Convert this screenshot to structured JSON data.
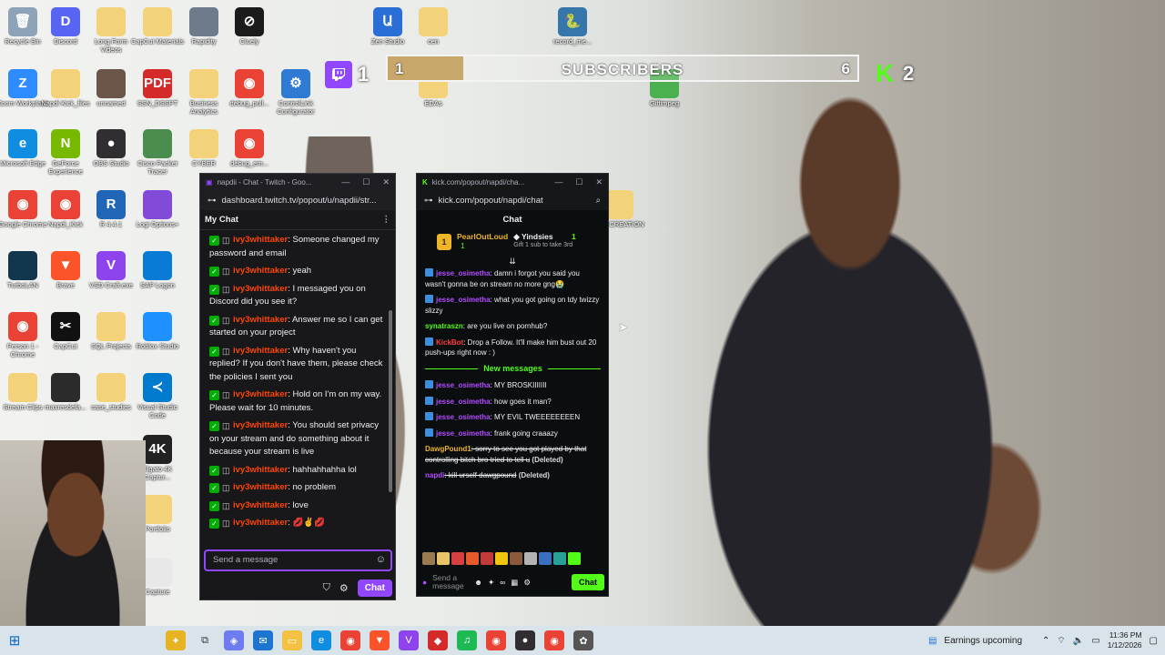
{
  "desktop": {
    "icons": [
      {
        "label": "Recycle Bin",
        "glyph": "🗑",
        "color": "#8fa3b8"
      },
      {
        "label": "Discord",
        "glyph": "D",
        "color": "#5865f2"
      },
      {
        "label": "Long Form Videos",
        "glyph": "",
        "color": "#f3d27a"
      },
      {
        "label": "CapCut Materials",
        "glyph": "",
        "color": "#f3d27a"
      },
      {
        "label": "Rapidity",
        "glyph": "",
        "color": "#6e7b8b"
      },
      {
        "label": "Cluely",
        "glyph": "⊘",
        "color": "#1b1b1b"
      },
      {
        "label": "Zen Studio",
        "glyph": "Ա",
        "color": "#2b6fd6"
      },
      {
        "label": "cen",
        "glyph": "",
        "color": "#f3d27a"
      },
      {
        "label": "record_me...",
        "glyph": "🐍",
        "color": "#3776ab"
      },
      {
        "label": "Zoom Workplace",
        "glyph": "Z",
        "color": "#2d8cff"
      },
      {
        "label": "Napdi Kick_files",
        "glyph": "",
        "color": "#f3d27a"
      },
      {
        "label": "unnamed",
        "glyph": "",
        "color": "#6b5548"
      },
      {
        "label": "SSN_DSSPT",
        "glyph": "PDF",
        "color": "#d42a2a"
      },
      {
        "label": "Business Analytics",
        "glyph": "",
        "color": "#f3d27a"
      },
      {
        "label": "debug_pull...",
        "glyph": "◉",
        "color": "#ea4335"
      },
      {
        "label": "ControlLink Configurator",
        "glyph": "⚙",
        "color": "#2f7bd3"
      },
      {
        "label": "EDAs",
        "glyph": "",
        "color": "#f3d27a"
      },
      {
        "label": "Giftimpeg",
        "glyph": "",
        "color": "#4caf50"
      },
      {
        "label": "Microsoft Edge",
        "glyph": "e",
        "color": "#0f8de0"
      },
      {
        "label": "GeForce Experience",
        "glyph": "N",
        "color": "#76b900"
      },
      {
        "label": "OBS Studio",
        "glyph": "●",
        "color": "#302e31"
      },
      {
        "label": "Cisco Packet Tracer",
        "glyph": "",
        "color": "#4a8d4f"
      },
      {
        "label": "CYBER",
        "glyph": "",
        "color": "#f3d27a"
      },
      {
        "label": "debug_em...",
        "glyph": "◉",
        "color": "#ea4335"
      },
      {
        "label": "Google Chrome",
        "glyph": "◉",
        "color": "#ea4335"
      },
      {
        "label": "Napdi_Kick",
        "glyph": "◉",
        "color": "#ea4335"
      },
      {
        "label": "R 4.4.1",
        "glyph": "R",
        "color": "#2165b6"
      },
      {
        "label": "Logi Options+",
        "glyph": "",
        "color": "#814ad8"
      },
      {
        "label": "APP CREATION",
        "glyph": "",
        "color": "#f3d27a"
      },
      {
        "label": "TurboLAN",
        "glyph": "",
        "color": "#13364f"
      },
      {
        "label": "Brave",
        "glyph": "▼",
        "color": "#fb542b"
      },
      {
        "label": "VSD Craft.exe",
        "glyph": "V",
        "color": "#8e44ec"
      },
      {
        "label": "SAP Logon",
        "glyph": "",
        "color": "#0a7bd4"
      },
      {
        "label": "Person 1 - Chrome",
        "glyph": "◉",
        "color": "#ea4335"
      },
      {
        "label": "CapCut",
        "glyph": "✂",
        "color": "#111111"
      },
      {
        "label": "SQL Projects",
        "glyph": "",
        "color": "#f3d27a"
      },
      {
        "label": "Roblox Studio",
        "glyph": "",
        "color": "#1e90ff"
      },
      {
        "label": "Stream Clips",
        "glyph": "",
        "color": "#f3d27a"
      },
      {
        "label": "maxresdefa...",
        "glyph": "",
        "color": "#2b2b2b"
      },
      {
        "label": "case_studies",
        "glyph": "",
        "color": "#f3d27a"
      },
      {
        "label": "Visual Studio Code",
        "glyph": "≺",
        "color": "#007acc"
      },
      {
        "label": "Elgato 4K Captur...",
        "glyph": "4K",
        "color": "#222222"
      },
      {
        "label": "Portfolio",
        "glyph": "",
        "color": "#f3d27a"
      },
      {
        "label": "Capture",
        "glyph": "",
        "color": "#e8e8e8"
      }
    ]
  },
  "overlay": {
    "twitch_count": "1",
    "kick_count": "2",
    "subscribers": {
      "current": "1",
      "goal": "6",
      "label": "SUBSCRIBERS",
      "progress": 0.16
    }
  },
  "twitch": {
    "window_title": "napdii - Chat - Twitch - Goo...",
    "url": "dashboard.twitch.tv/popout/u/napdii/str...",
    "header": "My Chat",
    "messages": [
      {
        "user": "ivy3whittaker",
        "text": ": Someone changed my password and email"
      },
      {
        "user": "ivy3whittaker",
        "text": ": yeah"
      },
      {
        "user": "ivy3whittaker",
        "text": ": I messaged you on Discord did you see it?"
      },
      {
        "user": "ivy3whittaker",
        "text": ": Answer me so I can get started on your project"
      },
      {
        "user": "ivy3whittaker",
        "text": ": Why haven't you replied? If you don't have them, please check the policies I sent you"
      },
      {
        "user": "ivy3whittaker",
        "text": ": Hold on I'm on my way. Please wait for 10 minutes."
      },
      {
        "user": "ivy3whittaker",
        "text": ": You should set privacy on your stream and do something about it because your stream is live"
      },
      {
        "user": "ivy3whittaker",
        "text": ": hahhahhahha lol"
      },
      {
        "user": "ivy3whittaker",
        "text": ": no problem"
      },
      {
        "user": "ivy3whittaker",
        "text": ": love"
      },
      {
        "user": "ivy3whittaker",
        "text": ": 💋✌️💋"
      }
    ],
    "input_placeholder": "Send a message",
    "chat_button": "Chat"
  },
  "kick": {
    "window_title": "kick.com/popout/napdi/cha...",
    "url": "kick.com/popout/napdi/chat",
    "header": "Chat",
    "pinned": {
      "rank": "1",
      "top_gifter": "PearlOutLoud",
      "top_gifter_count": "1",
      "second_user": "Yindsies",
      "second_count": "1",
      "gift_text": "Gift 1 sub to take 3rd"
    },
    "messages": [
      {
        "user": "jesse_osimetha",
        "color": "#b44bff",
        "text": ": damn i forgot you said you wasn't gonna be on stream no more gng😭",
        "badge": true
      },
      {
        "user": "jesse_osimetha",
        "color": "#b44bff",
        "text": ": what you got going on tdy twizzy slizzy",
        "badge": true
      },
      {
        "user": "synatraszn",
        "color": "#53fc18",
        "text": ": are you live on pornhub?",
        "badge": false
      },
      {
        "user": "KickBot",
        "color": "#ff3d3d",
        "text": ": Drop a Follow. It'll make him bust out 20 push-ups right now : )",
        "badge": true
      }
    ],
    "divider": "New messages",
    "new_messages": [
      {
        "user": "jesse_osimetha",
        "color": "#b44bff",
        "text": ": MY BROSKIIIIIII"
      },
      {
        "user": "jesse_osimetha",
        "color": "#b44bff",
        "text": ": how goes it man?"
      },
      {
        "user": "jesse_osimetha",
        "color": "#b44bff",
        "text": ": MY EVIL TWEEEEEEEEN"
      },
      {
        "user": "jesse_osimetha",
        "color": "#b44bff",
        "text": ": frank going craaazy"
      }
    ],
    "deleted": [
      {
        "user": "DawgPound1",
        "color": "#f0b429",
        "text": ": sorry to see you got played by that controlling bitch bro tried to tell u",
        "tag": "(Deleted)"
      },
      {
        "user": "napdi",
        "color": "#b44bff",
        "text": ": kill urself dawgpound",
        "tag": "(Deleted)"
      }
    ],
    "input_placeholder": "Send a message",
    "chat_button": "Chat"
  },
  "taskbar": {
    "notification": "Earnings upcoming",
    "time": "11:36 PM",
    "date": "1/12/2026"
  }
}
